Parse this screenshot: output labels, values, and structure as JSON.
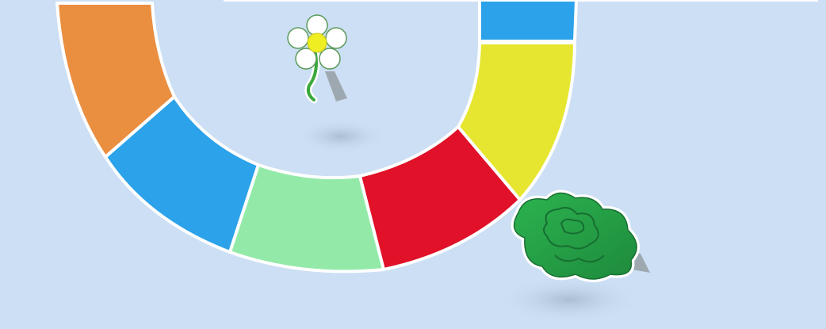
{
  "board": {
    "background": "#ccdff4",
    "path_border": "#ffffff",
    "spaces": [
      {
        "id": "orange",
        "color": "#ea8e40"
      },
      {
        "id": "blue-left",
        "color": "#2ba2e9"
      },
      {
        "id": "light-green",
        "color": "#93eaa8"
      },
      {
        "id": "red",
        "color": "#e01128"
      },
      {
        "id": "yellow",
        "color": "#e6e630"
      },
      {
        "id": "blue-top",
        "color": "#2ba2e9"
      }
    ]
  },
  "pieces": {
    "flower": {
      "icon": "flower-standee-icon",
      "petal": "#ffffff",
      "center": "#eeee22",
      "stem": "#3aa83a"
    },
    "bush": {
      "icon": "bush-standee-icon",
      "fill": "#249a45"
    }
  }
}
